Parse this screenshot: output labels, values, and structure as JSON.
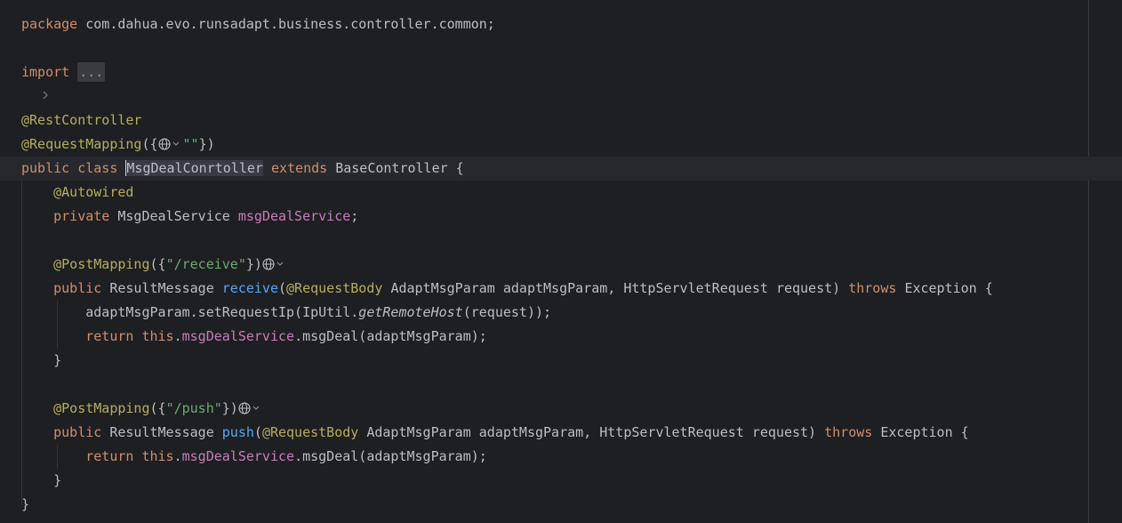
{
  "code": {
    "package_kw": "package",
    "package_name": " com.dahua.evo.runsadapt.business.controller.common;",
    "import_kw": "import",
    "import_folded": "...",
    "rest_controller": "@RestController",
    "request_mapping": "@RequestMapping",
    "request_mapping_open": "({",
    "request_mapping_str": "\"\"",
    "request_mapping_close": "})",
    "public_kw": "public",
    "class_kw": "class",
    "class_name": "MsgDealConrtoller",
    "extends_kw": "extends",
    "base_class": "BaseController {",
    "autowired": "@Autowired",
    "private_kw": "private",
    "service_type": "MsgDealService",
    "service_field": "msgDealService",
    "semicolon": ";",
    "post_mapping": "@PostMapping",
    "receive_path": "\"/receive\"",
    "push_path": "\"/push\"",
    "open_brace_paren": "({",
    "close_brace_paren": "})",
    "result_type": "ResultMessage",
    "receive_name": "receive",
    "push_name": "push",
    "request_body": "@RequestBody",
    "param_type": "AdaptMsgParam",
    "param_name": "adaptMsgParam,",
    "request_type": "HttpServletRequest",
    "request_name": "request)",
    "throws_kw": "throws",
    "exception": "Exception {",
    "set_ip_call": "adaptMsgParam.setRequestIp(IpUtil.",
    "get_remote_host": "getRemoteHost",
    "set_ip_tail": "(request));",
    "return_kw": "return",
    "this_kw": "this",
    "msg_deal_call": ".msgDeal(adaptMsgParam);",
    "close_brace": "}"
  },
  "icons": {
    "fold": "chevron-right-icon",
    "endpoint": "globe-icon"
  },
  "colors": {
    "background": "#1e1f22",
    "keyword": "#cf8e6d",
    "annotation": "#b3ae60",
    "string": "#6aab73",
    "function": "#56a8f5",
    "field": "#c77dbb",
    "text": "#bcbec4"
  }
}
